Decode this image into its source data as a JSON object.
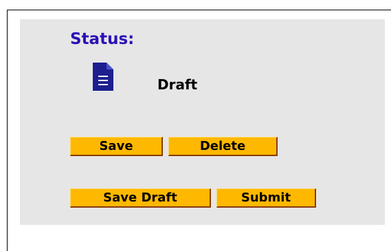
{
  "status": {
    "heading": "Status:",
    "value": "Draft",
    "icon": "document-icon"
  },
  "actions": {
    "save_label": "Save",
    "delete_label": "Delete",
    "save_draft_label": "Save Draft",
    "submit_label": "Submit"
  },
  "colors": {
    "heading": "#2a11b8",
    "icon": "#1d1f8f",
    "button_fill": "#ffb800",
    "button_shadow": "#8a3a00",
    "panel_background": "#e6e6e6"
  }
}
